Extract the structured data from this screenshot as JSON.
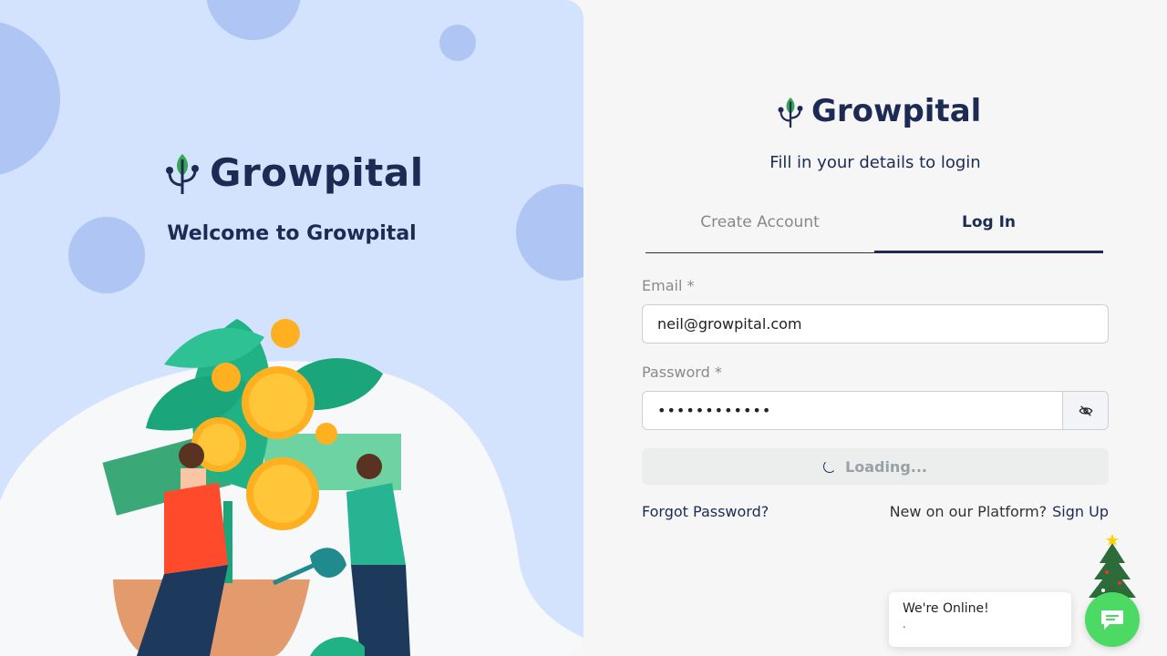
{
  "brand": {
    "name": "Growpital",
    "welcome": "Welcome to Growpital"
  },
  "login": {
    "subtitle": "Fill in your details to login",
    "tabs": [
      {
        "label": "Create Account",
        "active": false
      },
      {
        "label": "Log In",
        "active": true
      }
    ],
    "email_label": "Email *",
    "email_value": "neil@growpital.com",
    "password_label": "Password *",
    "password_value": "••••••••••••",
    "submit_label": "Loading...",
    "forgot_label": "Forgot Password?",
    "new_user_text": "New on our Platform?",
    "signup_label": "Sign Up"
  },
  "chat": {
    "status": "We're Online!",
    "subtext": "."
  },
  "colors": {
    "brand_navy": "#1d2b54",
    "left_bg": "#d3e2fd",
    "chat_green": "#4cd964"
  }
}
